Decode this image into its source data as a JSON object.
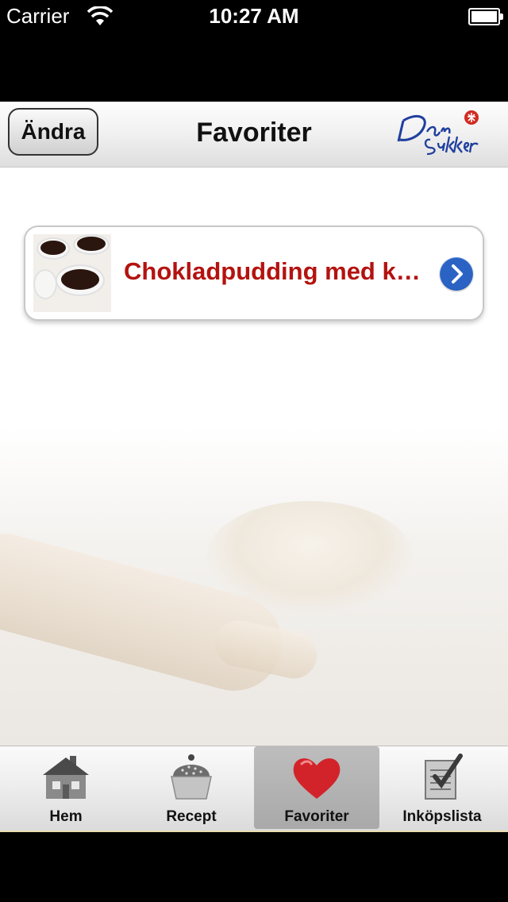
{
  "status_bar": {
    "carrier": "Carrier",
    "time": "10:27 AM"
  },
  "nav": {
    "title": "Favoriter",
    "edit_label": "Ändra",
    "logo_alt": "Dan Sukker"
  },
  "favorites": [
    {
      "title": "Chokladpudding med k…"
    }
  ],
  "tabs": [
    {
      "label": "Hem",
      "icon": "house-icon",
      "selected": false
    },
    {
      "label": "Recept",
      "icon": "cupcake-icon",
      "selected": false
    },
    {
      "label": "Favoriter",
      "icon": "heart-icon",
      "selected": true
    },
    {
      "label": "Inköpslista",
      "icon": "checklist-icon",
      "selected": false
    }
  ],
  "colors": {
    "accent_red": "#b3130f",
    "disclosure_blue": "#2a63c4",
    "logo_blue": "#1f3f9e"
  }
}
